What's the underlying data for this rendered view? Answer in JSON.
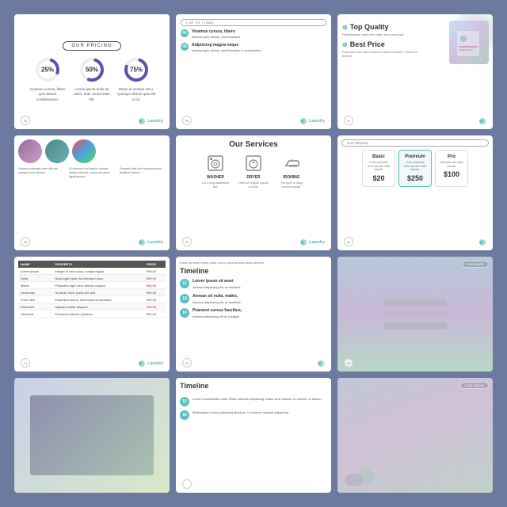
{
  "slides": {
    "pricing": {
      "badge": "OUR PRICING",
      "items": [
        {
          "percent": "25%",
          "desc": "Vivamus cursus, libero quis dictum condimentum."
        },
        {
          "percent": "50%",
          "desc": "Lorem ipsum dolor sit amet, ante consectetur elit."
        },
        {
          "percent": "75%",
          "desc": "Etiam et semper arcu. Quisque dictum quis elit in eu."
        }
      ]
    },
    "list_of_items": {
      "badge": "LIST OF ITEMS",
      "items": [
        {
          "num": "01",
          "title": "Vivamus cursus, libero",
          "desc": "Aenean quis dictum, ante faucibus."
        },
        {
          "num": "02",
          "title": "Adipiscing magna neque",
          "desc": "Aenean quis dictum, ante faucibus in consectetur."
        }
      ]
    },
    "top_quality": {
      "title1": "Top Quality",
      "desc1": "Pellentesque eget nibh vitae nisi consequat",
      "title2": "Best Price",
      "desc2": "Praesent velit nibh rhoncus metus at dictum. Fusce in dictum."
    },
    "photos": {
      "captions": [
        "Vivamus vulputate vitae nibh vel natoque lorem dictum.",
        "Ut ultrices et vel lacinia. Aenean ultrices nisl erat, cursus est amet ligula tempus.",
        "Praesent velit nibh rhoncus metus faucibus fontium."
      ]
    },
    "services": {
      "title": "Our Services",
      "items": [
        {
          "icon": "🔧",
          "name": "WASHER",
          "desc": "It is a long established fact."
        },
        {
          "icon": "🚿",
          "name": "DRYER",
          "desc": "Diam sit volupat, massa in nullis."
        },
        {
          "icon": "👕",
          "name": "IRONING",
          "desc": "The cycle of using content typeset."
        }
      ]
    },
    "plans": {
      "badge": "OUR PRICING",
      "items": [
        {
          "name": "Basic",
          "desc": "Proin vulputate vehicula odio vitae blandit.",
          "price": "$20"
        },
        {
          "name": "Premium",
          "desc": "Proin vulputate vehicula odio vitae blandit.",
          "price": "$250",
          "featured": true
        },
        {
          "name": "Pro",
          "desc": "Vehicula odio vitae blandit.",
          "price": "$100"
        }
      ]
    },
    "table": {
      "headers": [
        "NAME",
        "PROPERTY",
        "PRICE"
      ],
      "rows": [
        [
          "Lorem ipsum",
          "Integer in vel cursus, congue ligula",
          "999.00"
        ],
        [
          "Nulla",
          "Nulla eget pede dui interdum nunc",
          "999.00"
        ],
        [
          "Metus",
          "Phasellus eget urna ultrices congue",
          "959.00"
        ],
        [
          "Venenatis",
          "Sit amet, nibh, porta est velit",
          "999.00"
        ],
        [
          "Proin nibh",
          "Phasellus metus, nisl metus consectetur",
          "999.00"
        ],
        [
          "Parturient",
          "Aliquam mattis aliquam",
          "769.00"
        ],
        [
          "Tincidunt",
          "Parturient ultrices pharetra",
          "899.00"
        ]
      ]
    },
    "timeline_right": {
      "title": "Timeline",
      "desc": "Etiam sit amet lorem nulla. Nunc porta facilisis aulla Aenean",
      "items": [
        {
          "num": "11",
          "title": "Lorem ipsum sit amet",
          "desc": "Aenean adipiscing elit, at tincidunt."
        },
        {
          "num": "13",
          "title": "Aenean sit nulla, mattis,",
          "desc": "Aenean adipiscing elit, at tincidunt."
        },
        {
          "num": "14",
          "title": "Praesent cursus faucibus,",
          "desc": "Aenean adipiscing elit at volutpat."
        }
      ]
    },
    "timeline_bottom": {
      "title": "Timeline",
      "items": [
        {
          "num": "15",
          "desc": "Lorem a sollicitudin dolor. Etiam Aenean adipiscing. Etiam at et ultrices, id ultrices, id dictum."
        },
        {
          "num": "16",
          "desc": "Malesuada Lorem adipiscing faucibus. Ut Aenean congue adipiscing."
        }
      ]
    },
    "img_timeline": {
      "badge": "OUR TIMING"
    },
    "strip": {
      "badge": "FIND MORE"
    },
    "logos": {
      "brand": "Laundry"
    },
    "page_numbers": [
      "35",
      "36",
      "37",
      "38",
      "39",
      "40",
      "41",
      "42",
      "43"
    ]
  }
}
